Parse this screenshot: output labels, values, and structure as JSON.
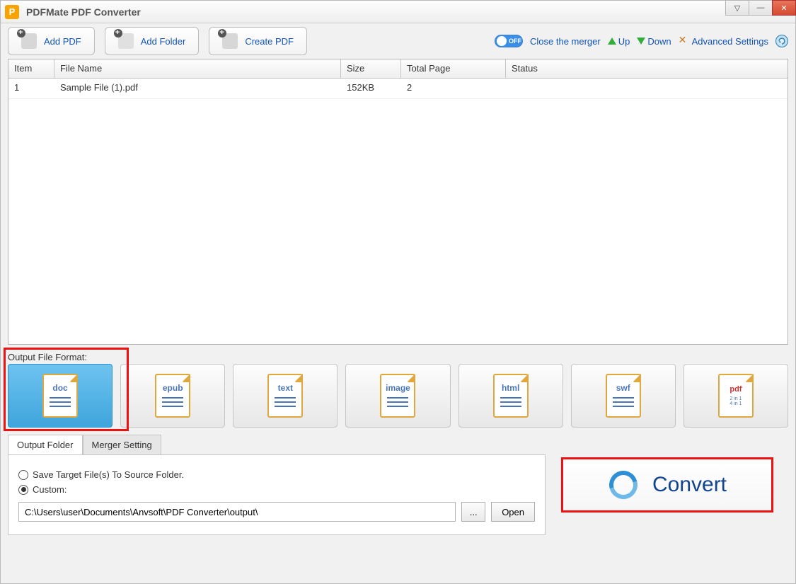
{
  "titlebar": {
    "title": "PDFMate PDF Converter"
  },
  "toolbar": {
    "add_pdf": "Add PDF",
    "add_folder": "Add Folder",
    "create_pdf": "Create PDF",
    "close_merger": "Close the merger",
    "up": "Up",
    "down": "Down",
    "advanced": "Advanced Settings"
  },
  "table": {
    "headers": {
      "item": "Item",
      "name": "File Name",
      "size": "Size",
      "page": "Total Page",
      "status": "Status"
    },
    "rows": [
      {
        "item": "1",
        "name": "Sample File (1).pdf",
        "size": "152KB",
        "page": "2",
        "status": ""
      }
    ]
  },
  "formats": {
    "label": "Output File Format:",
    "items": [
      "doc",
      "epub",
      "text",
      "image",
      "html",
      "swf",
      "pdf"
    ],
    "pdf_sub1": "2 in 1",
    "pdf_sub2": "4 in 1"
  },
  "tabs": {
    "output": "Output Folder",
    "merger": "Merger Setting"
  },
  "output": {
    "save_source": "Save Target File(s) To Source Folder.",
    "custom": "Custom:",
    "path": "C:\\Users\\user\\Documents\\Anvsoft\\PDF Converter\\output\\",
    "browse": "...",
    "open": "Open"
  },
  "convert": "Convert"
}
